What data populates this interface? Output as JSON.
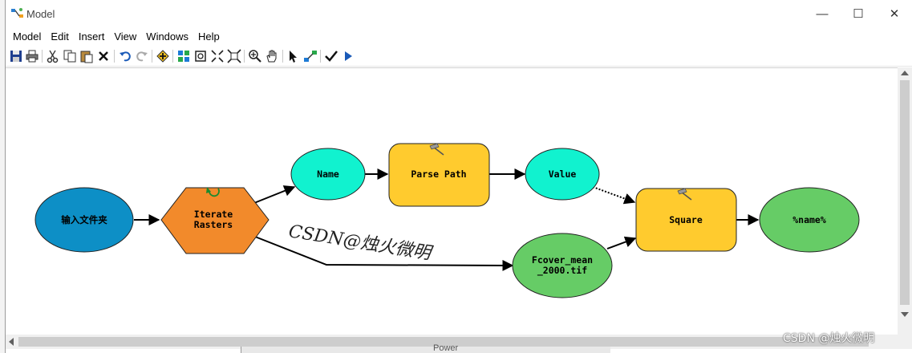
{
  "window": {
    "title": "Model",
    "controls": {
      "minimize": "—",
      "maximize": "☐",
      "close": "✕"
    }
  },
  "menu": [
    "Model",
    "Edit",
    "Insert",
    "View",
    "Windows",
    "Help"
  ],
  "toolbar_icons": [
    "save-icon",
    "print-icon",
    "cut-icon",
    "copy-icon",
    "paste-icon",
    "delete-icon",
    "undo-icon",
    "redo-icon",
    "add-data-icon",
    "auto-layout-icon",
    "full-extent-icon",
    "fixed-zoom-in-icon",
    "fixed-zoom-out-icon",
    "zoom-in-icon",
    "pan-icon",
    "select-icon",
    "connect-icon",
    "validate-icon",
    "run-icon"
  ],
  "nodes": {
    "input_folder": "输入文件夹",
    "iterate_line1": "Iterate",
    "iterate_line2": "Rasters",
    "name": "Name",
    "parse_path": "Parse Path",
    "value": "Value",
    "square": "Square",
    "output": "%name%",
    "raster_line1": "Fcover_mean",
    "raster_line2": "_2000.tif"
  },
  "colors": {
    "input_blue": "#0d8fc6",
    "iterator_orange": "#f28a2b",
    "variable_cyan": "#11f2cf",
    "tool_yellow": "#ffcb2e",
    "data_green": "#66cc66"
  },
  "watermarks": {
    "canvas": "CSDN@烛火微明",
    "corner": "CSDN @烛火微明"
  },
  "background_window_label": "Power"
}
